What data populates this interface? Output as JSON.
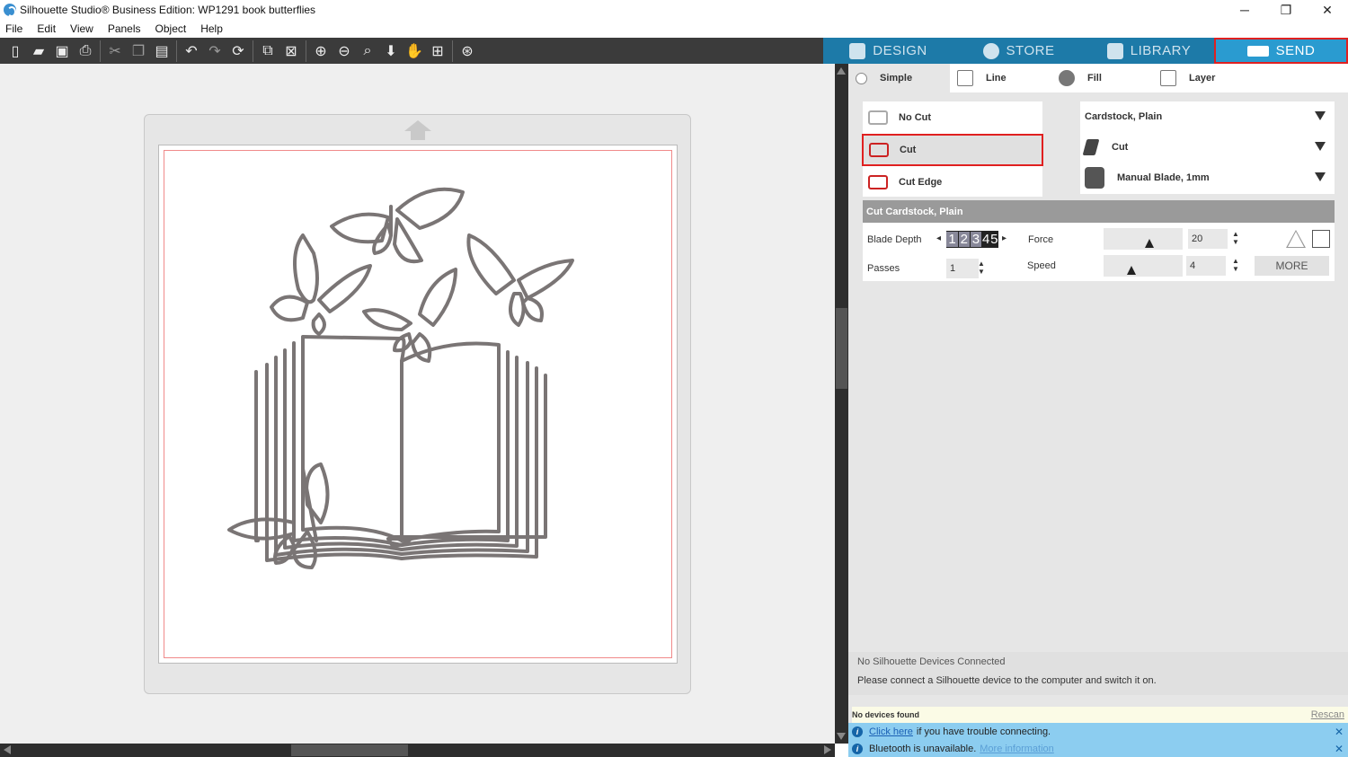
{
  "window": {
    "title": "Silhouette Studio® Business Edition: WP1291 book butterflies",
    "controls": [
      "─",
      "❐",
      "✕"
    ]
  },
  "menu": [
    "File",
    "Edit",
    "View",
    "Panels",
    "Object",
    "Help"
  ],
  "toolbar_icons": [
    "new-document-icon",
    "open-folder-icon",
    "save-icon",
    "print-icon",
    "cut-icon",
    "copy-icon",
    "paste-icon",
    "undo-icon",
    "redo-icon",
    "redraw-icon",
    "group-icon",
    "ungroup-icon",
    "zoom-in-icon",
    "zoom-out-icon",
    "zoom-select-icon",
    "move-down-icon",
    "pan-hand-icon",
    "fit-page-icon",
    "pixscan-icon"
  ],
  "nav_tabs": [
    {
      "label": "DESIGN",
      "icon": "grid-icon"
    },
    {
      "label": "STORE",
      "icon": "store-logo-icon"
    },
    {
      "label": "LIBRARY",
      "icon": "download-icon"
    },
    {
      "label": "SEND",
      "icon": "cutter-icon"
    }
  ],
  "mode_tabs": [
    "Simple",
    "Line",
    "Fill",
    "Layer"
  ],
  "cut_options": [
    "No Cut",
    "Cut",
    "Cut Edge"
  ],
  "material": {
    "type": "Cardstock, Plain",
    "action": "Cut",
    "tool": "Manual Blade, 1mm"
  },
  "settings": {
    "header": "Cut Cardstock, Plain",
    "blade_depth_label": "Blade Depth",
    "blade_depth_digits": [
      "1",
      "2",
      "3",
      "4",
      "5"
    ],
    "passes_label": "Passes",
    "passes_value": "1",
    "force_label": "Force",
    "force_value": "20",
    "speed_label": "Speed",
    "speed_value": "4",
    "more_label": "MORE"
  },
  "devices": {
    "status": "No Silhouette Devices Connected",
    "hint": "Please connect a Silhouette device to the computer and switch it on.",
    "no_devices": "No devices found",
    "rescan": "Rescan"
  },
  "notices": [
    {
      "link": "Click here",
      "text": "if you have trouble connecting."
    },
    {
      "text": "Bluetooth is unavailable.",
      "link": "More information"
    }
  ]
}
